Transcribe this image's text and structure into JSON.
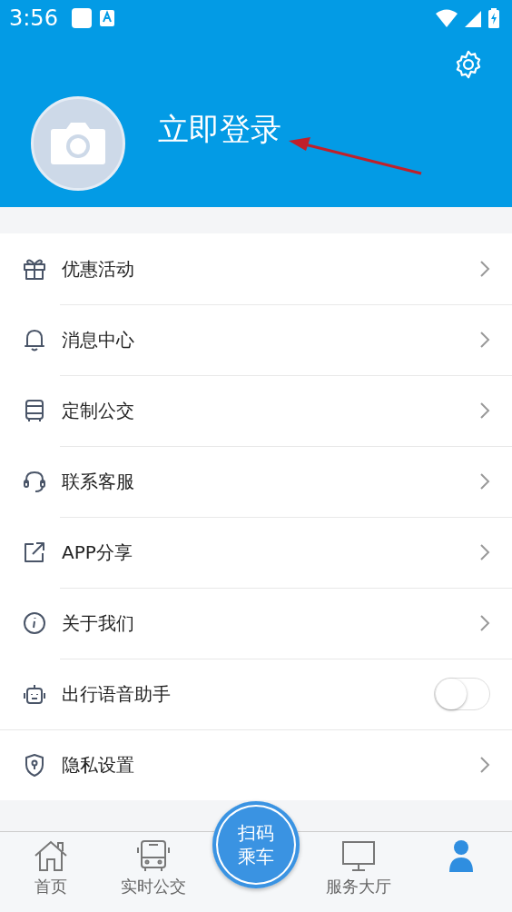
{
  "status_bar": {
    "time": "3:56"
  },
  "profile": {
    "login_label": "立即登录"
  },
  "menu": [
    {
      "label": "优惠活动",
      "kind": "link"
    },
    {
      "label": "消息中心",
      "kind": "link"
    },
    {
      "label": "定制公交",
      "kind": "link"
    },
    {
      "label": "联系客服",
      "kind": "link"
    },
    {
      "label": "APP分享",
      "kind": "link"
    },
    {
      "label": "关于我们",
      "kind": "link"
    },
    {
      "label": "出行语音助手",
      "kind": "toggle",
      "on": false
    },
    {
      "label": "隐私设置",
      "kind": "link"
    }
  ],
  "tab_bar": {
    "tabs": [
      {
        "label": "首页",
        "selected": false
      },
      {
        "label": "实时公交",
        "selected": false
      },
      {
        "label": "扫码乘车",
        "kind": "scan"
      },
      {
        "label": "服务大厅",
        "selected": false
      },
      {
        "selected": true
      }
    ]
  }
}
